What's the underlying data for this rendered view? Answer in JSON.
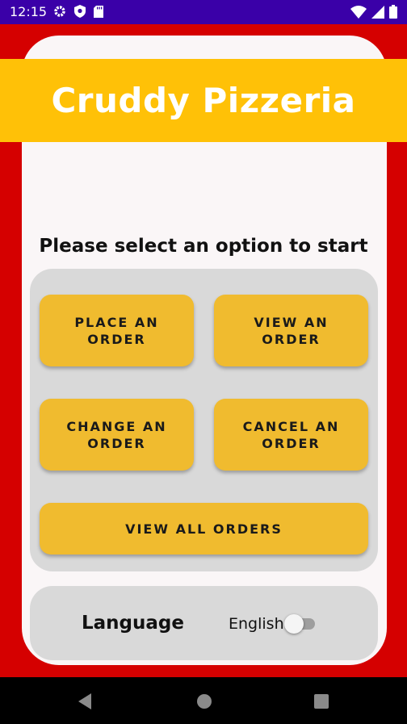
{
  "status_bar": {
    "time": "12:15",
    "left_icons": [
      "gear-icon",
      "shield-icon",
      "sd-card-icon"
    ],
    "right_icons": [
      "wifi-icon",
      "signal-icon",
      "battery-icon"
    ],
    "background": "#3a00a8"
  },
  "app": {
    "title": "Cruddy Pizzeria",
    "prompt": "Please select an option to start",
    "colors": {
      "background": "#d50000",
      "banner": "#ffc107",
      "button": "#f0bb2f",
      "panel": "#d9d9d9",
      "card": "#faf6f7"
    }
  },
  "options": {
    "place_order": "PLACE AN ORDER",
    "view_order": "VIEW AN ORDER",
    "change_order": "CHANGE AN ORDER",
    "cancel_order": "CANCEL AN ORDER",
    "view_all": "VIEW ALL ORDERS"
  },
  "language": {
    "label": "Language",
    "value": "English",
    "toggle_on": false
  },
  "nav_bar": {
    "icons": [
      "back-icon",
      "home-icon",
      "recents-icon"
    ]
  }
}
